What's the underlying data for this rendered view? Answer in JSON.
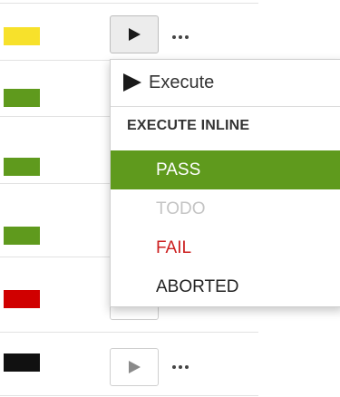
{
  "rows": [
    {
      "status_color": "#f7e12b",
      "run_button_state": "active"
    },
    {
      "status_color": "#5f9a1d"
    },
    {
      "status_color": "#5f9a1d"
    },
    {
      "status_color": "#5f9a1d"
    },
    {
      "status_color": "#d00000"
    },
    {
      "status_color": "#111111",
      "run_button_state": "idle"
    }
  ],
  "icons": {
    "run": "play-icon",
    "more": "more-dots-icon"
  },
  "context_menu": {
    "execute_label": "Execute",
    "section_header": "EXECUTE INLINE",
    "options": [
      {
        "label": "PASS",
        "color": "#5f9a1d",
        "highlighted": true
      },
      {
        "label": "TODO",
        "color": "#c4c4c4"
      },
      {
        "label": "FAIL",
        "color": "#cc1f1f"
      },
      {
        "label": "ABORTED",
        "color": "#222222"
      }
    ]
  }
}
